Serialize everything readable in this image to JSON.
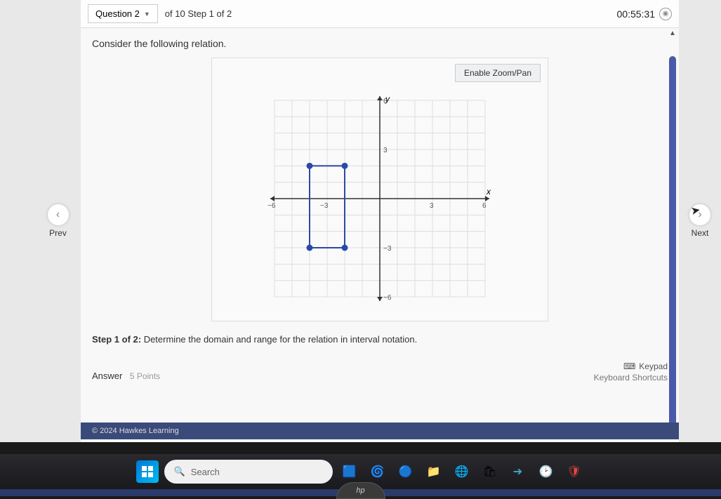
{
  "header": {
    "question_label": "Question 2",
    "step_label": "of 10 Step 1 of 2",
    "timer": "00:55:31"
  },
  "nav": {
    "prev": "Prev",
    "next": "Next"
  },
  "content": {
    "instruction": "Consider the following relation.",
    "zoom_label": "Enable Zoom/Pan",
    "step_bold": "Step 1 of 2:",
    "step_desc": " Determine the domain and range for the relation in interval notation.",
    "answer_label": "Answer",
    "points": "5 Points",
    "keypad": "Keypad",
    "kshort": "Keyboard Shortcuts"
  },
  "chart_data": {
    "type": "scatter",
    "title": "",
    "xlabel": "x",
    "ylabel": "y",
    "xlim": [
      -6,
      6
    ],
    "ylim": [
      -6,
      6
    ],
    "xticks": [
      -6,
      -3,
      3,
      6
    ],
    "yticks": [
      -6,
      -3,
      3,
      6
    ],
    "shapes": [
      {
        "type": "rectangle",
        "x0": -4,
        "y0": -3,
        "x1": -2,
        "y1": 2
      }
    ],
    "points": [
      {
        "x": -4,
        "y": 2
      },
      {
        "x": -2,
        "y": 2
      },
      {
        "x": -4,
        "y": -3
      },
      {
        "x": -2,
        "y": -3
      }
    ]
  },
  "footer": {
    "copy": "© 2024 Hawkes Learning"
  },
  "taskbar": {
    "search_ph": "Search"
  }
}
